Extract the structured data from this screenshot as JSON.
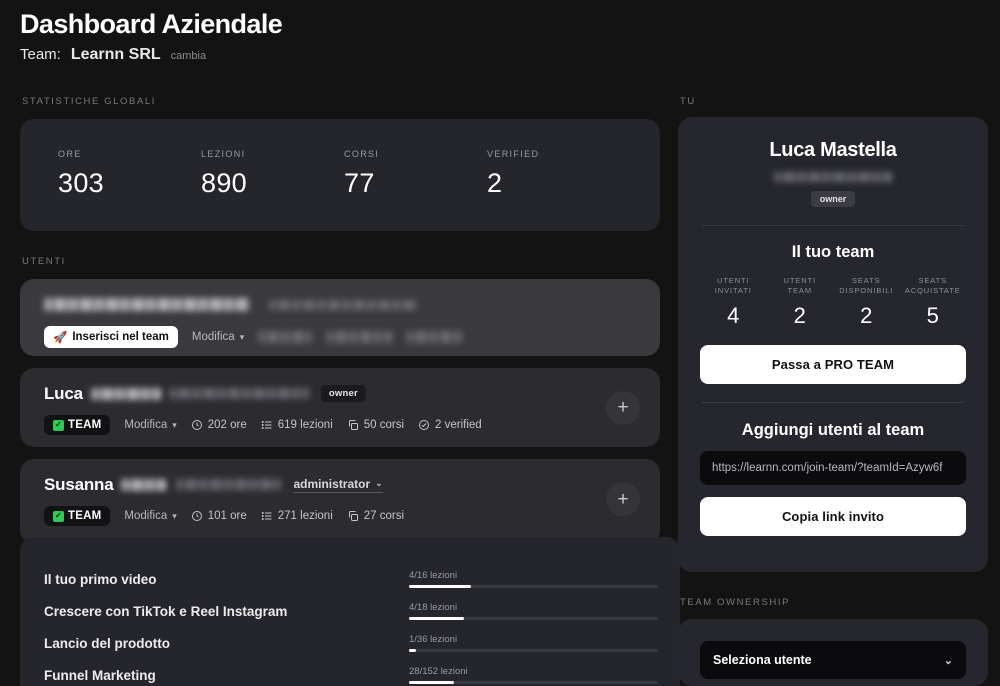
{
  "header": {
    "title": "Dashboard Aziendale",
    "team_label": "Team:",
    "team_name": "Learnn SRL",
    "change_link": "cambia"
  },
  "sections": {
    "global_stats_caption": "STATISTICHE GLOBALI",
    "users_caption": "UTENTI",
    "you_caption": "TU",
    "ownership_caption": "TEAM OWNERSHIP"
  },
  "global_stats": [
    {
      "label": "ORE",
      "value": "303"
    },
    {
      "label": "LEZIONI",
      "value": "890"
    },
    {
      "label": "CORSI",
      "value": "77"
    },
    {
      "label": "VERIFIED",
      "value": "2"
    }
  ],
  "users": [
    {
      "name": "",
      "name_redacted": true,
      "email_redacted": true,
      "role": "",
      "invite_button": "Inserisci nel team",
      "invite_icon": "rocket-icon",
      "edit_label": "Modifica",
      "stats": [],
      "has_team_badge": false,
      "has_plus": false
    },
    {
      "name": "Luca",
      "name_redacted": true,
      "role": "owner",
      "role_type": "pill",
      "team_badge": "TEAM",
      "edit_label": "Modifica",
      "stats": [
        {
          "icon": "clock-icon",
          "text": "202 ore"
        },
        {
          "icon": "list-icon",
          "text": "619 lezioni"
        },
        {
          "icon": "copy-icon",
          "text": "50 corsi"
        },
        {
          "icon": "check-circle-icon",
          "text": "2 verified"
        }
      ],
      "has_team_badge": true,
      "has_plus": true
    },
    {
      "name": "Susanna",
      "name_redacted": true,
      "role": "administrator",
      "role_type": "select",
      "team_badge": "TEAM",
      "edit_label": "Modifica",
      "stats": [
        {
          "icon": "clock-icon",
          "text": "101 ore"
        },
        {
          "icon": "list-icon",
          "text": "271 lezioni"
        },
        {
          "icon": "copy-icon",
          "text": "27 corsi"
        }
      ],
      "has_team_badge": true,
      "has_plus": true
    }
  ],
  "courses": [
    {
      "name": "Il tuo primo video",
      "progress_label": "4/16 lezioni",
      "completed": 4,
      "total": 16,
      "percent": 25
    },
    {
      "name": "Crescere con TikTok e Reel Instagram",
      "progress_label": "4/18 lezioni",
      "completed": 4,
      "total": 18,
      "percent": 22
    },
    {
      "name": "Lancio del prodotto",
      "progress_label": "1/36 lezioni",
      "completed": 1,
      "total": 36,
      "percent": 3
    },
    {
      "name": "Funnel Marketing",
      "progress_label": "28/152 lezioni",
      "completed": 28,
      "total": 152,
      "percent": 18
    }
  ],
  "you": {
    "name": "Luca Mastella",
    "email_redacted": true,
    "role_badge": "owner",
    "team_title": "Il tuo team",
    "team_stats": [
      {
        "label": "UTENTI\nINVITATI",
        "line1": "UTENTI",
        "line2": "INVITATI",
        "value": "4"
      },
      {
        "label": "UTENTI\nTEAM",
        "line1": "UTENTI",
        "line2": "TEAM",
        "value": "2"
      },
      {
        "label": "SEATS\nDISPONIBILI",
        "line1": "SEATS",
        "line2": "DISPONIBILI",
        "value": "2"
      },
      {
        "label": "SEATS\nACQUISTATE",
        "line1": "SEATS",
        "line2": "ACQUISTATE",
        "value": "5"
      }
    ],
    "pro_button": "Passa a PRO TEAM",
    "add_users_title": "Aggiungi utenti al team",
    "invite_link": "https://learnn.com/join-team/?teamId=Azyw6f",
    "copy_button": "Copia link invito"
  },
  "ownership": {
    "select_value": "Seleziona utente"
  },
  "colors": {
    "page_bg": "#131314",
    "card_bg": "#25252c",
    "side_card_bg": "#26262e",
    "pending_row_bg": "#3a3a3e",
    "accent_white": "#ffffff",
    "green": "#33c65a",
    "muted_text": "#9a9aa2"
  }
}
